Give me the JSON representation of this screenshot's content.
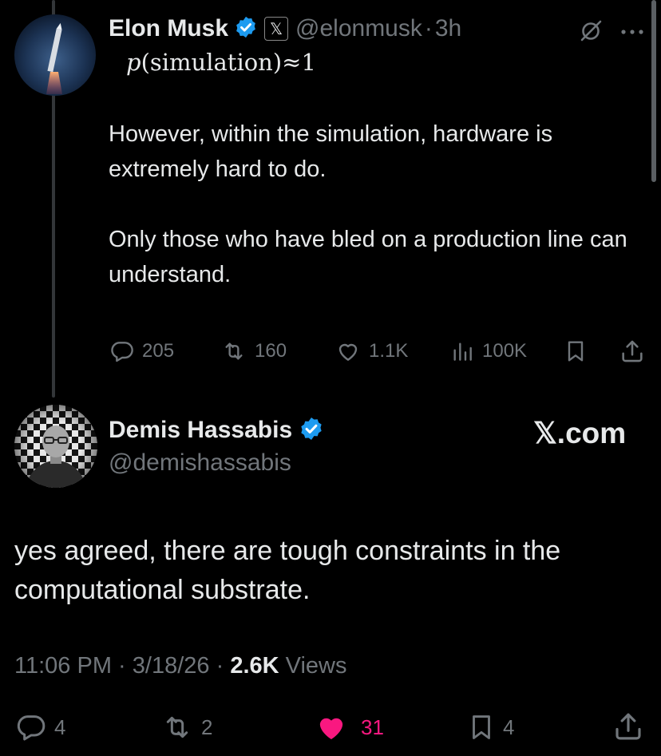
{
  "colors": {
    "background": "#000000",
    "text": "#e7e9ea",
    "muted": "#71767b",
    "verified": "#1d9bf0",
    "like_active": "#f91880",
    "thread_line": "#333639"
  },
  "parent": {
    "name": "Elon Musk",
    "affiliate_badge": "𝕏",
    "handle": "@elonmusk",
    "dot": "·",
    "time": "3h",
    "formula_italic": "p",
    "formula_rest": "(simulation)≈1",
    "body": "However, within the simulation, hardware is extremely hard to do.\n\nOnly those who have bled on a production line can understand.",
    "replies": "205",
    "reposts": "160",
    "likes": "1.1K",
    "views": "100K",
    "icons": [
      "grok-icon",
      "more-icon",
      "reply-icon",
      "repost-icon",
      "like-icon",
      "views-icon",
      "bookmark-icon",
      "share-icon"
    ]
  },
  "reply": {
    "name": "Demis Hassabis",
    "handle": "@demishassabis",
    "brand": "𝕏.com",
    "body": "yes agreed, there are tough constraints in the computational substrate.",
    "time": "11:06 PM",
    "sep1": "·",
    "date": "3/18/26",
    "sep2": "·",
    "views_count": "2.6K",
    "views_label": "Views",
    "replies": "4",
    "reposts": "2",
    "likes": "31",
    "bookmarks": "4"
  }
}
